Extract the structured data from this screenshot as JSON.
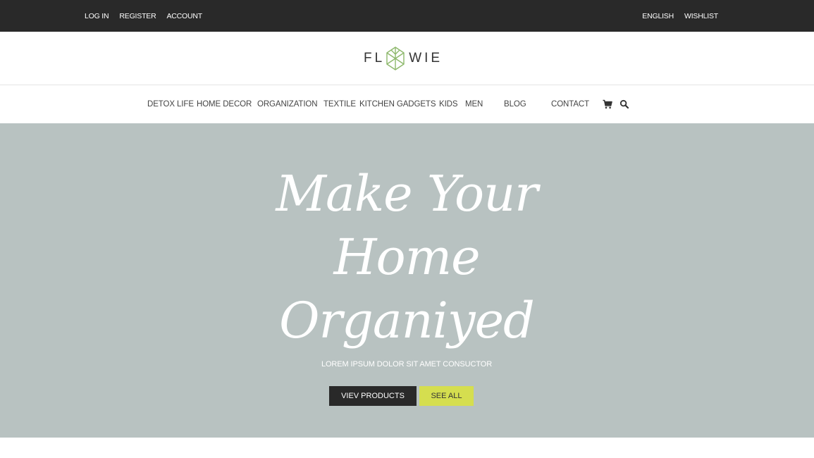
{
  "topbar": {
    "left_links": [
      "LOG IN",
      "REGISTER",
      "ACCOUNT"
    ],
    "right_links": [
      "ENGLISH",
      "WISHLIST"
    ]
  },
  "logo": {
    "text_left": "FL",
    "text_right": "WIE",
    "mark_color": "#8db86b"
  },
  "nav": {
    "items": [
      "DETOX LIFE",
      "HOME DECOR",
      "ORGANIZATION",
      "TEXTILE",
      "KITCHEN GADGETS",
      "KIDS",
      "MEN",
      "BLOG",
      "CONTACT"
    ],
    "icons": [
      "cart-icon",
      "search-icon"
    ]
  },
  "hero": {
    "headline_lines": [
      "Make Your",
      "Home",
      "Organiyed"
    ],
    "subtitle": "LOREM IPSUM DOLOR SIT AMET CONSUCTOR",
    "primary_button": "VIEV PRODUCTS",
    "secondary_button": "SEE ALL",
    "background": "#b8c2c1",
    "accent": "#d5de4f"
  }
}
